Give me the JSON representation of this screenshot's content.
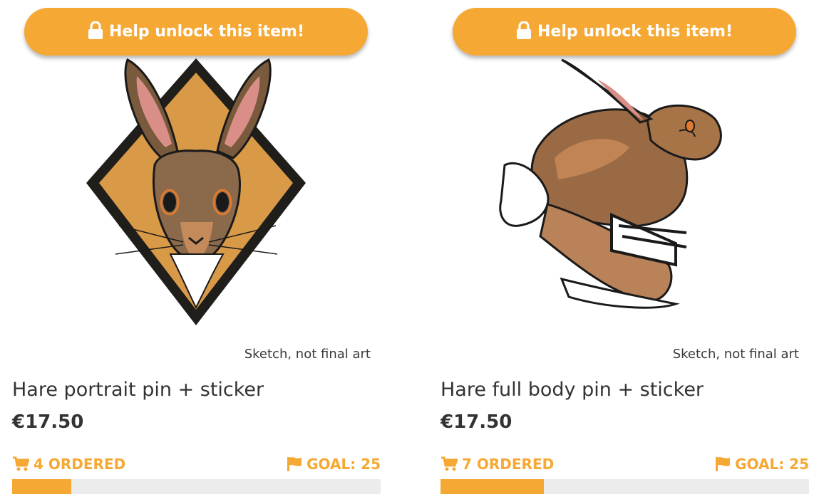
{
  "products": [
    {
      "unlock_label": "Help unlock this item!",
      "image_icon": "hare-portrait-sketch",
      "sketch_note": "Sketch, not final art",
      "title": "Hare portrait pin + sticker",
      "price": "€17.50",
      "ordered_label": "4 ORDERED",
      "goal_label": "GOAL: 25",
      "ordered": 4,
      "goal": 25,
      "progress_fraction": 0.16
    },
    {
      "unlock_label": "Help unlock this item!",
      "image_icon": "hare-full-body-sketch",
      "sketch_note": "Sketch, not final art",
      "title": "Hare full body pin + sticker",
      "price": "€17.50",
      "ordered_label": "7 ORDERED",
      "goal_label": "GOAL: 25",
      "ordered": 7,
      "goal": 25,
      "progress_fraction": 0.28
    }
  ],
  "colors": {
    "accent": "#f6a834",
    "track": "#ececec",
    "text": "#333333"
  }
}
